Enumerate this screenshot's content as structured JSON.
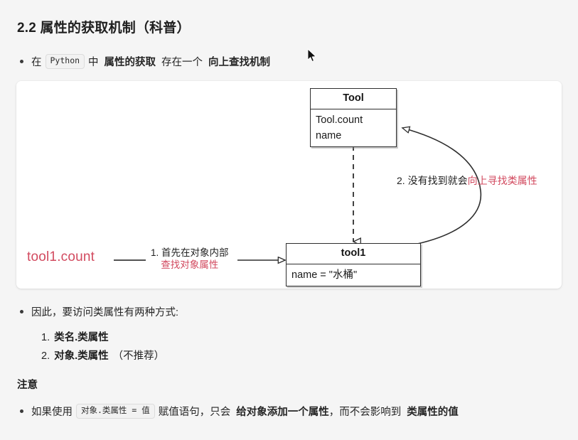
{
  "page": {
    "background_color": "#f5f5f5",
    "accent_red": "#d24a5f",
    "text_color": "#262626"
  },
  "heading": {
    "text": "2.2 属性的获取机制（科普）"
  },
  "intro": {
    "prefix": "在",
    "code": "Python",
    "mid": "中",
    "bold1": "属性的获取",
    "mid2": "存在一个",
    "bold2": "向上查找机制"
  },
  "diagram": {
    "class_box": {
      "title": "Tool",
      "rows": [
        "Tool.count",
        "name"
      ]
    },
    "instance_box": {
      "title": "tool1",
      "rows": [
        "name = \"水桶\""
      ]
    },
    "lookup_expression": "tool1.count",
    "step1": {
      "line1": "1. 首先在对象内部",
      "line2": "查找对象属性"
    },
    "step2": {
      "dark": "2. 没有找到就会",
      "red": "向上寻找类属性"
    }
  },
  "conclusion": {
    "bullet": "因此，要访问类属性有两种方式:",
    "items": [
      {
        "num": "1.",
        "label": "类名.类属性",
        "note": ""
      },
      {
        "num": "2.",
        "label": "对象.类属性",
        "note": "（不推荐）"
      }
    ]
  },
  "notice": {
    "heading": "注意",
    "prefix": "如果使用",
    "code": "对象.类属性 = 值",
    "mid": "赋值语句，只会",
    "bold1": "给对象添加一个属性",
    "mid2": "，而不会影响到",
    "bold2": "类属性的值"
  },
  "cursor": {
    "icon": "mouse-pointer"
  }
}
